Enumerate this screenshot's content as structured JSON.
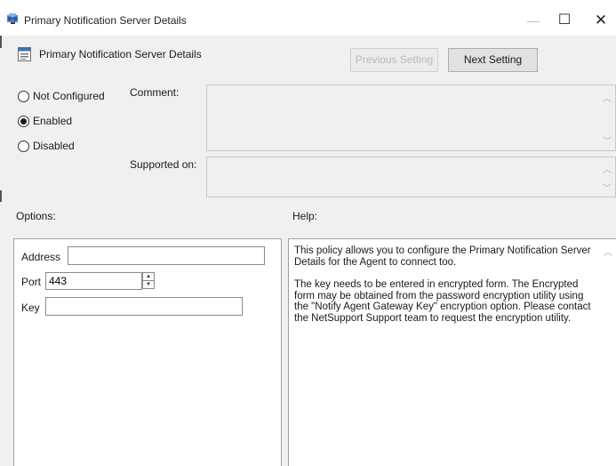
{
  "window": {
    "title": "Primary Notification Server Details",
    "minimize_glyph": "—",
    "maximize_glyph": "☐",
    "close_glyph": "✕"
  },
  "header": {
    "policy_title": "Primary Notification Server Details",
    "previous_label": "Previous Setting",
    "next_label": "Next Setting"
  },
  "state": {
    "options": [
      {
        "label": "Not Configured",
        "selected": false
      },
      {
        "label": "Enabled",
        "selected": true
      },
      {
        "label": "Disabled",
        "selected": false
      }
    ]
  },
  "comment": {
    "label": "Comment:",
    "value": ""
  },
  "supported": {
    "label": "Supported on:",
    "value": ""
  },
  "options_panel": {
    "label": "Options:",
    "address": {
      "label": "Address",
      "value": ""
    },
    "port": {
      "label": "Port",
      "value": "443"
    },
    "key": {
      "label": "Key",
      "value": ""
    }
  },
  "help_panel": {
    "label": "Help:",
    "paragraphs": [
      "This policy allows you to configure the Primary Notification Server Details for the Agent to connect too.",
      "The key needs to be entered in encrypted form. The Encrypted form may be obtained from the password encryption utility using the \"Notify Agent Gateway Key\" encryption option. Please contact the NetSupport Support team to request the encryption utility."
    ]
  },
  "icons": {
    "window": "policy-window-icon",
    "setting": "policy-setting-icon",
    "scroll_up": "scroll-up-arrow-icon",
    "scroll_down": "scroll-down-arrow-icon"
  },
  "colors": {
    "dialog_bg": "#f0f0f0",
    "titlebar_bg": "#ffffff",
    "button_bg": "#e1e1e1",
    "disabled_text": "#b9b9b9"
  }
}
